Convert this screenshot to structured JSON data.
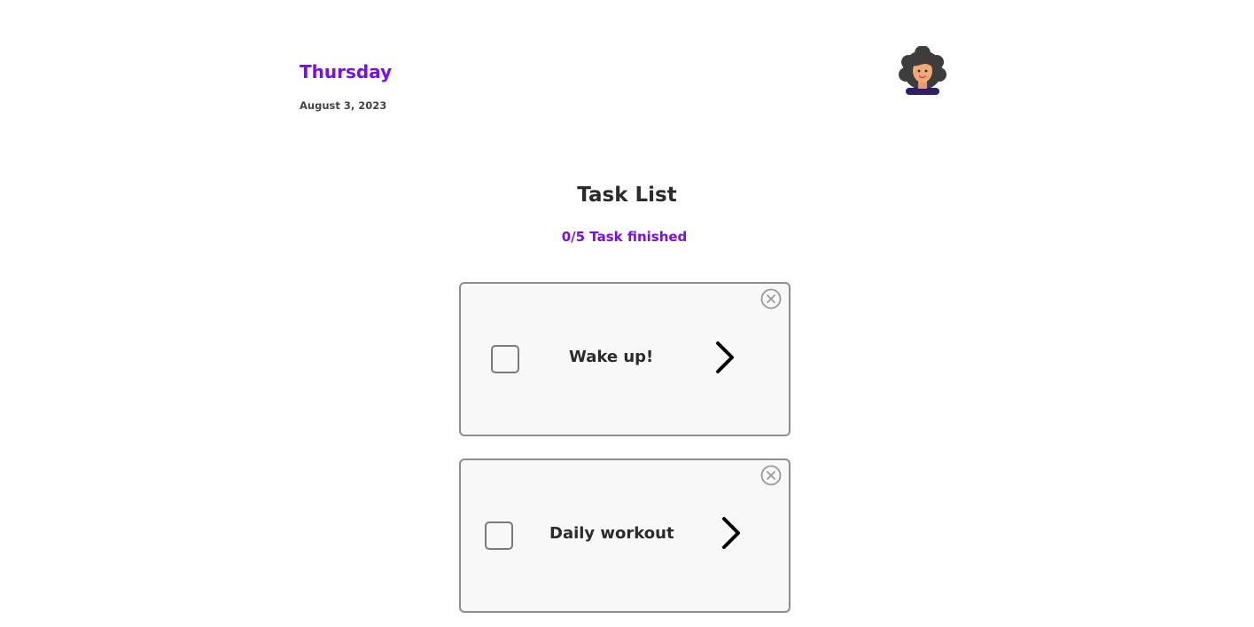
{
  "header": {
    "day": "Thursday",
    "date": "August 3, 2023",
    "avatar_icon": "user-avatar-icon"
  },
  "main": {
    "title": "Task List",
    "progress_text": "0/5 Task finished",
    "tasks": [
      {
        "label": "Wake up!",
        "completed": false
      },
      {
        "label": "Daily workout",
        "completed": false
      }
    ]
  },
  "colors": {
    "accent": "#7A0EE6",
    "text": "#2b2b2b",
    "card_border": "#8e8e8e",
    "card_background": "#f8f8f8"
  },
  "icons": {
    "close": "close-circle-icon",
    "open": "chevron-right-icon",
    "checkbox": "checkbox-icon"
  }
}
